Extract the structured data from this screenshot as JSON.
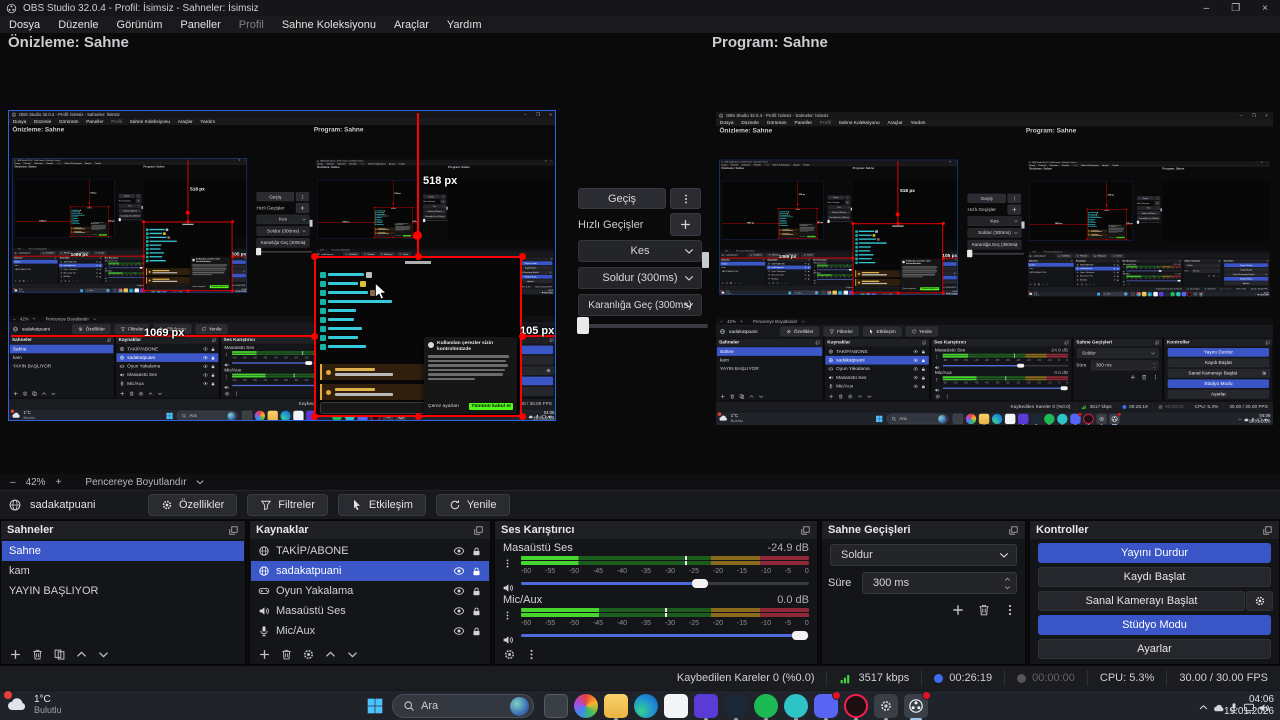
{
  "window": {
    "title": "OBS Studio 32.0.4 - Profil: İsimsiz - Sahneler: İsimsiz",
    "menu": [
      "Dosya",
      "Düzenle",
      "Görünüm",
      "Paneller",
      "Profil",
      "Sahne Koleksiyonu",
      "Araçlar",
      "Yardım"
    ],
    "controls": {
      "minimize": "–",
      "restore": "❐",
      "close": "×"
    }
  },
  "studio": {
    "preview_label": "Önizleme: Sahne",
    "program_label": "Program: Sahne",
    "transition_button": "Geçiş",
    "quick_transitions_label": "Hızlı Geçişler",
    "quick_items": [
      "Kes",
      "Soldur (300ms)",
      "Karanlığa Geç (300ms)"
    ],
    "measure": {
      "top": "518 px",
      "left": "1069 px",
      "right": "105 px"
    }
  },
  "zoom_bar": {
    "minus": "–",
    "level": "42%",
    "plus": "+",
    "fit": "Pencereye Boyutlandır"
  },
  "source_toolbar": {
    "source_name": "sadakatpuani",
    "properties": "Özellikler",
    "filters": "Filtreler",
    "interact": "Etkileşim",
    "refresh": "Yenile"
  },
  "scenes": {
    "title": "Sahneler",
    "items": [
      "Sahne",
      "kam",
      "YAYIN BAŞLIYOR"
    ]
  },
  "sources": {
    "title": "Kaynaklar",
    "items": [
      "TAKİP/ABONE",
      "sadakatpuani",
      "Oyun Yakalama",
      "Masaüstü Ses",
      "Mic/Aux"
    ]
  },
  "mixer": {
    "title": "Ses Karıştırıcı",
    "channels": [
      {
        "name": "Masaüstü Ses",
        "db": "-24.9 dB"
      },
      {
        "name": "Mic/Aux",
        "db": "0.0 dB"
      }
    ],
    "ticks": [
      "-60",
      "-55",
      "-50",
      "-45",
      "-40",
      "-35",
      "-30",
      "-25",
      "-20",
      "-15",
      "-10",
      "-5",
      "0"
    ]
  },
  "transitions": {
    "title": "Sahne Geçişleri",
    "current": "Soldur",
    "duration_label": "Süre",
    "duration": "300 ms"
  },
  "controls_panel": {
    "title": "Kontroller",
    "stream": "Yayını Durdur",
    "record": "Kaydı Başlat",
    "vcam": "Sanal Kamerayı Başlat",
    "studio": "Stüdyo Modu",
    "settings": "Ayarlar"
  },
  "status": {
    "dropped": "Kaybedilen Kareler 0 (%0.0)",
    "bitrate": "3517 kbps",
    "stream_time": "00:26:19",
    "record_time": "00:00:00",
    "cpu": "CPU: 5.3%",
    "fps": "30.00 / 30.00 FPS"
  },
  "taskbar": {
    "temp": "1°C",
    "condition": "Bulutlu",
    "search": "Ara",
    "time": "04:06",
    "date": "19.01.2026"
  },
  "chat": {
    "cookie_title": "Kullanılan çerezler sizin kontrolünüzde",
    "cookie_settings": "Çerez ayarları",
    "cookie_accept": "Tümünü kabul et"
  },
  "colors": {
    "accent_blue": "#3b57c8",
    "selection_red": "#ff0000",
    "kick_green": "#53fc18"
  }
}
